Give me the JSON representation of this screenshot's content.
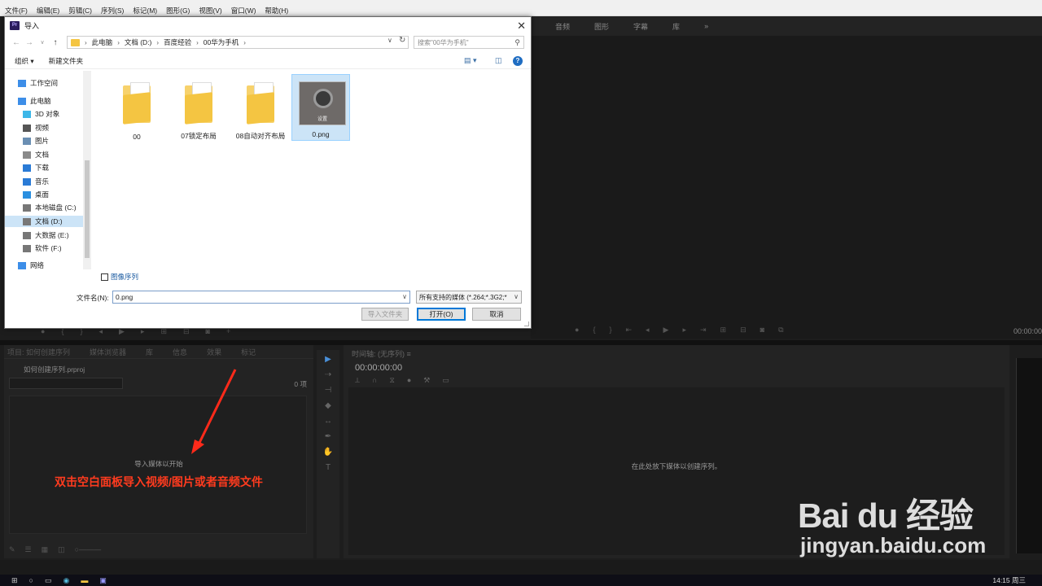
{
  "app": {
    "menus": [
      "文件(F)",
      "编辑(E)",
      "剪辑(C)",
      "序列(S)",
      "标记(M)",
      "图形(G)",
      "视图(V)",
      "窗口(W)",
      "帮助(H)"
    ],
    "workspace_tabs": [
      "音频",
      "图形",
      "字幕",
      "库",
      "»"
    ],
    "program_timecode": "00:00:00",
    "project_tabs": [
      "项目: 如何创建序列",
      "媒体浏览器",
      "库",
      "信息",
      "效果",
      "标记"
    ],
    "project_file": "如何创建序列.prproj",
    "project_count": "0 项",
    "project_hint": "导入媒体以开始",
    "annotation": "双击空白面板导入视频/图片或者音频文件",
    "timeline_tab": "时间轴: (无序列) ≡",
    "timeline_tc": "00:00:00:00",
    "timeline_hint": "在此处放下媒体以创建序列。",
    "clock": "14:15 周三"
  },
  "watermark": {
    "line1": "Bai du 经验",
    "line2": "jingyan.baidu.com"
  },
  "dialog": {
    "title": "导入",
    "close": "✕",
    "breadcrumb": [
      "此电脑",
      "文档 (D:)",
      "百度经验",
      "00华为手机"
    ],
    "search_placeholder": "搜索\"00华为手机\"",
    "organize": "组织 ▾",
    "new_folder": "新建文件夹",
    "help": "?",
    "nav": [
      {
        "label": "工作空间",
        "icon": "star-icon",
        "color": "#3d8ee8"
      },
      {
        "label": "此电脑",
        "icon": "computer-icon",
        "color": "#3d8ee8"
      },
      {
        "label": "3D 对象",
        "icon": "cube-icon",
        "color": "#3db7e8"
      },
      {
        "label": "视频",
        "icon": "video-icon",
        "color": "#555555"
      },
      {
        "label": "图片",
        "icon": "image-icon",
        "color": "#6a8fb3"
      },
      {
        "label": "文档",
        "icon": "document-icon",
        "color": "#8a8a8a"
      },
      {
        "label": "下载",
        "icon": "download-icon",
        "color": "#2a7bd6"
      },
      {
        "label": "音乐",
        "icon": "music-icon",
        "color": "#2a7bd6"
      },
      {
        "label": "桌面",
        "icon": "desktop-icon",
        "color": "#2a8fe0"
      },
      {
        "label": "本地磁盘 (C:)",
        "icon": "drive-icon",
        "color": "#777777"
      },
      {
        "label": "文档 (D:)",
        "icon": "drive-icon",
        "color": "#777777"
      },
      {
        "label": "大数据 (E:)",
        "icon": "drive-icon",
        "color": "#777777"
      },
      {
        "label": "软件 (F:)",
        "icon": "drive-icon",
        "color": "#777777"
      },
      {
        "label": "网络",
        "icon": "network-icon",
        "color": "#3d8ee8"
      }
    ],
    "files": [
      {
        "name": "00",
        "type": "folder"
      },
      {
        "name": "07锁定布局",
        "type": "folder"
      },
      {
        "name": "08自动对齐布局",
        "type": "folder"
      },
      {
        "name": "0.png",
        "type": "image",
        "caption": "设置"
      }
    ],
    "image_sequence_label": "图像序列",
    "filename_label": "文件名(N):",
    "filename_value": "0.png",
    "filetype_value": "所有支持的媒体 (*.264;*.3G2;*",
    "import_folder_btn": "导入文件夹",
    "open_btn": "打开(O)",
    "cancel_btn": "取消"
  }
}
